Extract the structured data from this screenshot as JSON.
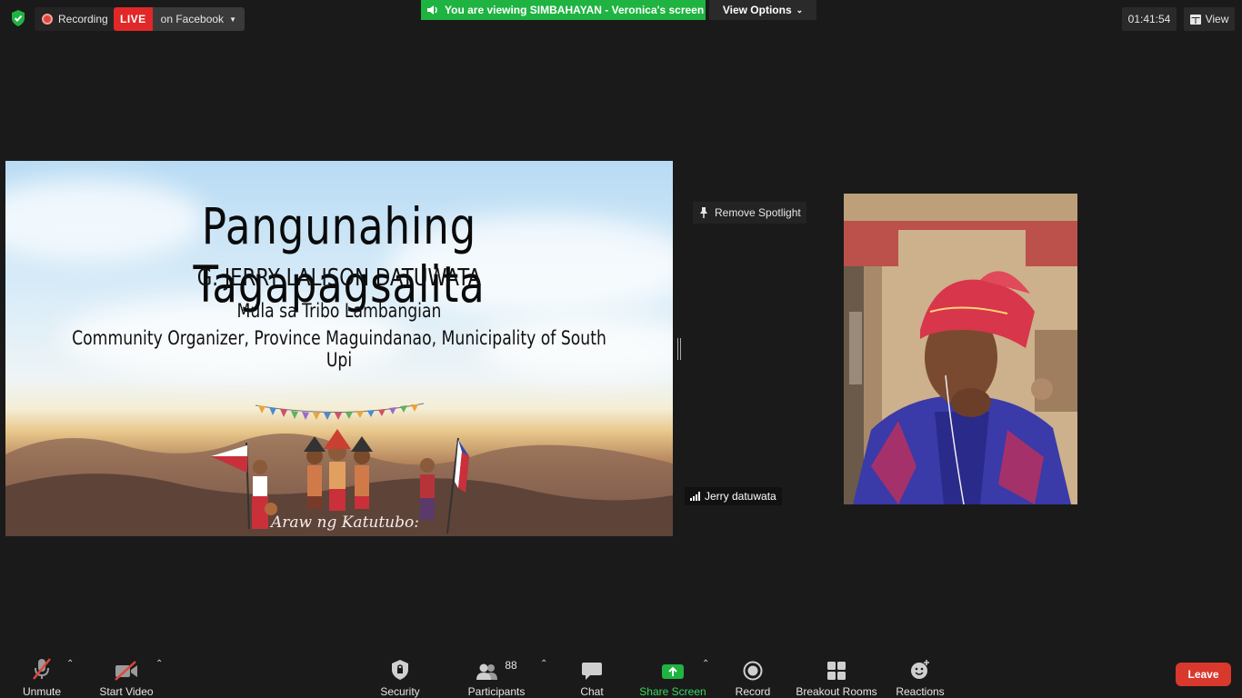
{
  "topbar": {
    "recording_label": "Recording",
    "live_label": "LIVE",
    "live_target": "on Facebook",
    "viewing_banner": "You are viewing SIMBAHAYAN - Veronica's screen",
    "view_options_label": "View Options",
    "elapsed_time": "01:41:54",
    "view_label": "View"
  },
  "shared_screen": {
    "title": "Pangunahing Tagapagsalita",
    "speaker_name": "G. JERRY LALISON DATUWATA",
    "tribe": "Mula sa Tribo Lambangian",
    "role": "Community Organizer, Province Maguindanao, Municipality of South Upi",
    "script_caption": "Araw ng Katutubo:"
  },
  "spotlight": {
    "remove_label": "Remove Spotlight"
  },
  "participant_video": {
    "name": "Jerry datuwata"
  },
  "toolbar": {
    "unmute_label": "Unmute",
    "start_video_label": "Start Video",
    "security_label": "Security",
    "participants_label": "Participants",
    "participants_count": "88",
    "chat_label": "Chat",
    "share_screen_label": "Share Screen",
    "record_label": "Record",
    "breakout_rooms_label": "Breakout Rooms",
    "reactions_label": "Reactions",
    "leave_label": "Leave"
  },
  "colors": {
    "background": "#1a1a1a",
    "live_red": "#e02828",
    "viewing_green": "#1fb341",
    "share_green": "#3ad660",
    "leave_red": "#d9382d"
  }
}
